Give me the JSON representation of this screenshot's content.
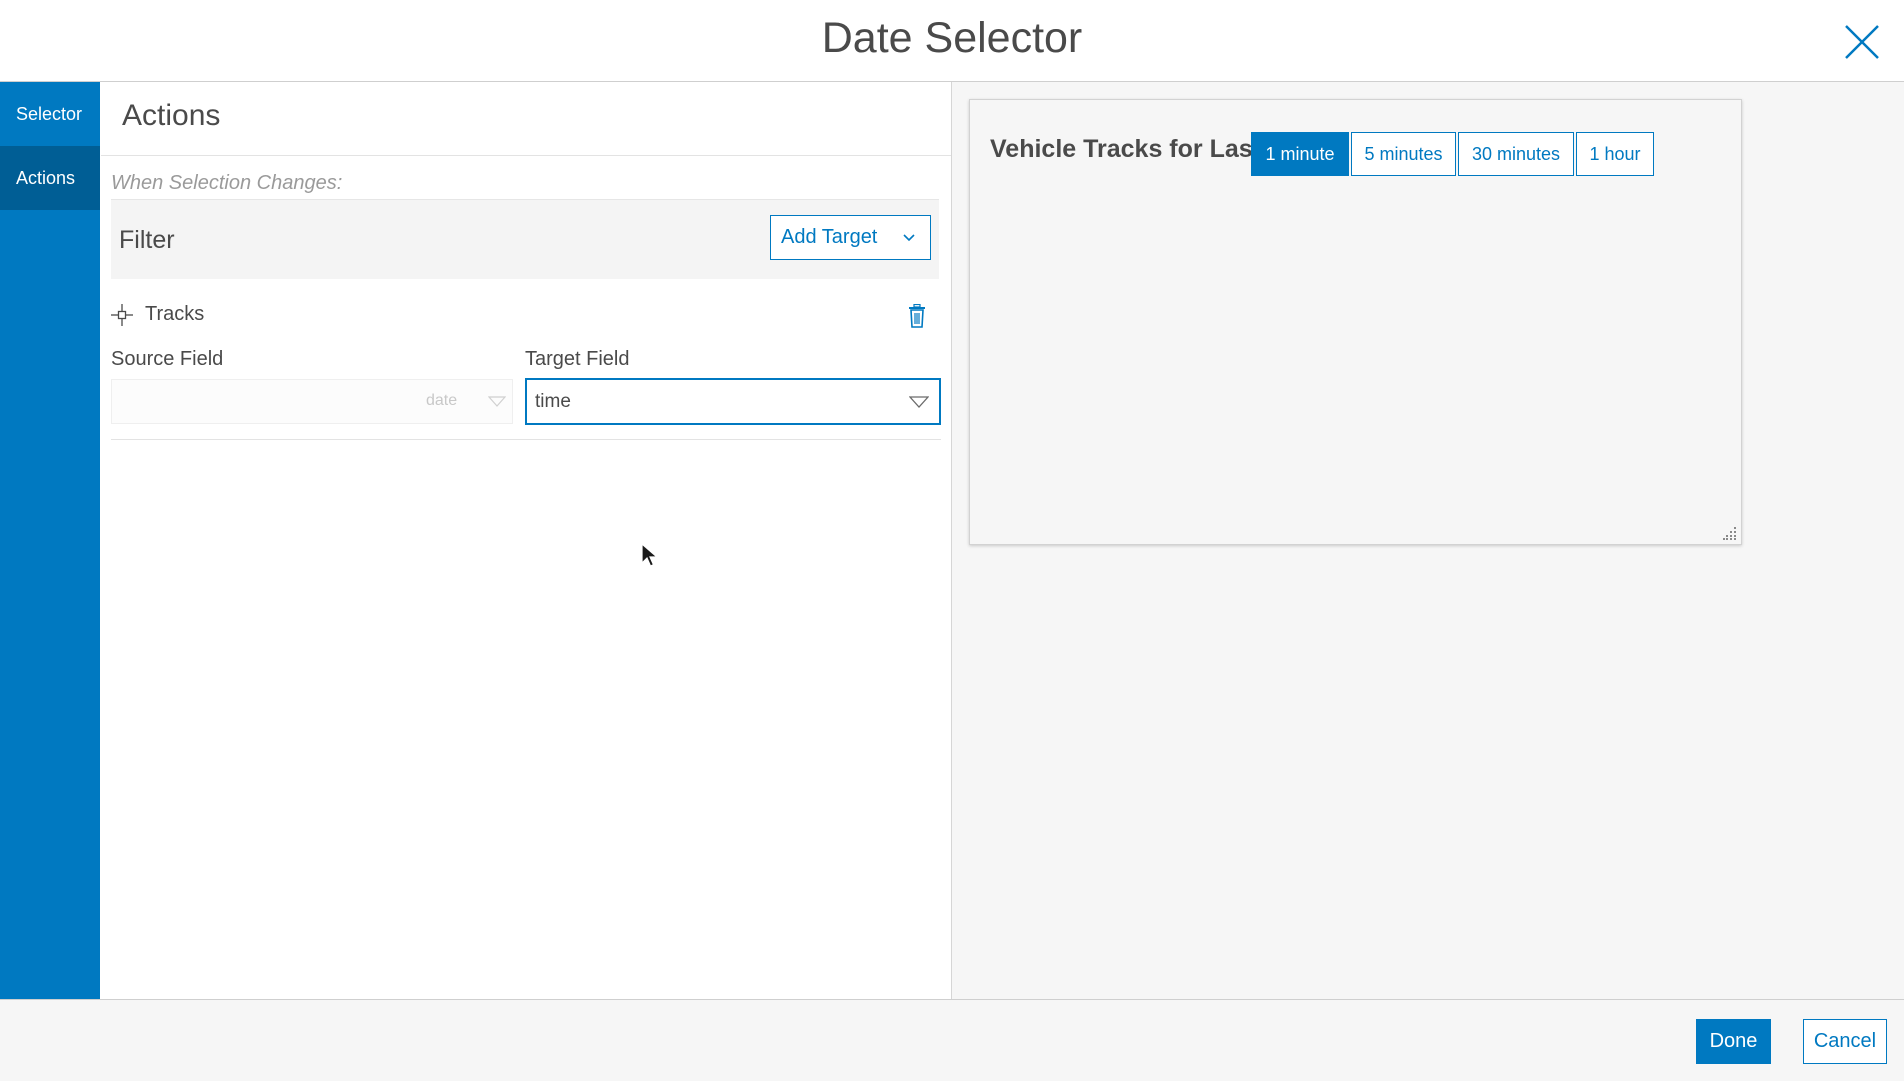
{
  "dialog": {
    "title": "Date Selector",
    "close_icon": "close-icon"
  },
  "sidebar": {
    "items": [
      {
        "label": "Selector",
        "active": false
      },
      {
        "label": "Actions",
        "active": true
      }
    ]
  },
  "actions_panel": {
    "title": "Actions",
    "section_label": "When Selection Changes:",
    "filter": {
      "title": "Filter",
      "add_target_label": "Add Target"
    },
    "target": {
      "icon": "crosshair-icon",
      "name": "Tracks",
      "delete_icon": "trash-icon",
      "source_field_label": "Source Field",
      "source_field_type": "date",
      "target_field_label": "Target Field",
      "target_field_value": "time"
    }
  },
  "preview": {
    "label": "Vehicle Tracks for Last",
    "options": [
      {
        "label": "1 minute",
        "active": true
      },
      {
        "label": "5 minutes",
        "active": false
      },
      {
        "label": "30 minutes",
        "active": false
      },
      {
        "label": "1 hour",
        "active": false
      }
    ]
  },
  "footer": {
    "done_label": "Done",
    "cancel_label": "Cancel"
  },
  "colors": {
    "accent": "#0079c1",
    "accent_dark": "#005e95",
    "text": "#4a4a4a",
    "muted": "#9a9a9a"
  }
}
